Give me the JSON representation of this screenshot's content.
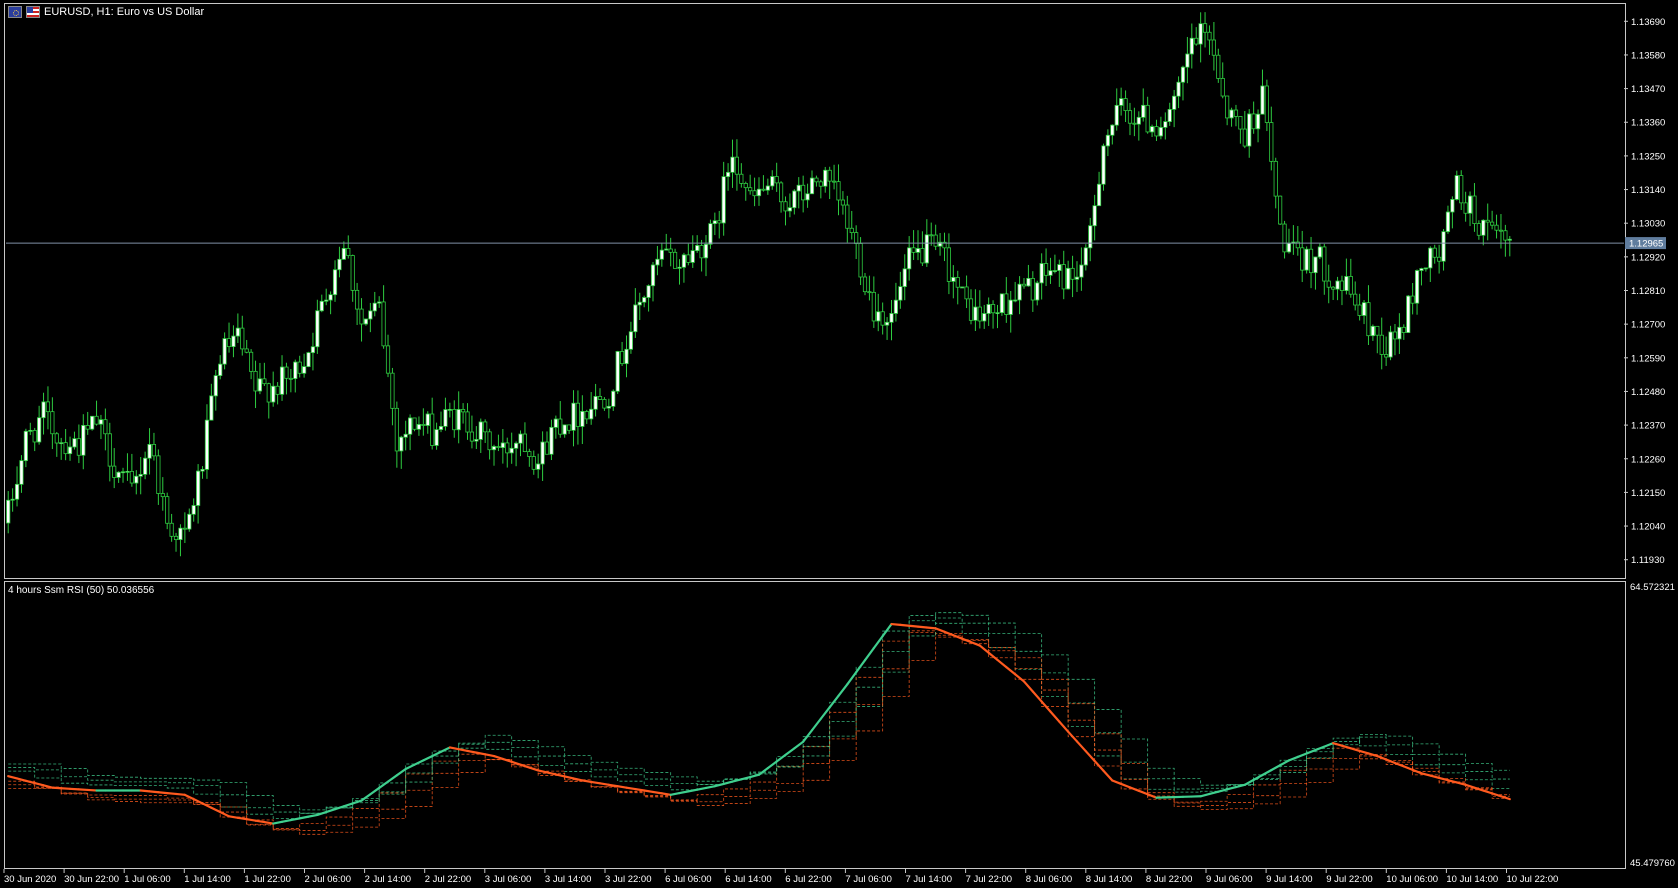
{
  "window": {
    "title": "EURUSD, H1:  Euro vs US Dollar",
    "flag_left_icon": "eu-flag-icon",
    "flag_right_icon": "us-flag-icon"
  },
  "colors": {
    "background": "#000000",
    "bull_candle": "#ffffff",
    "bear_candle": "#000000",
    "wick": "#2ecc40",
    "bid_line": "#7f8fa6",
    "rsi_up": "#3fcf8e",
    "rsi_down": "#ff5a1f",
    "level_up": "#3fcf8e",
    "level_down": "#ff5a1f"
  },
  "price_axis": {
    "labels": [
      "1.13690",
      "1.13580",
      "1.13470",
      "1.13360",
      "1.13250",
      "1.13140",
      "1.13030",
      "1.12920",
      "1.12810",
      "1.12700",
      "1.12590",
      "1.12480",
      "1.12370",
      "1.12260",
      "1.12150",
      "1.12040",
      "1.11930"
    ],
    "current_price": "1.12965",
    "range": [
      1.1188,
      1.1374
    ]
  },
  "indicator": {
    "title": "4 hours Ssm RSI (50) 50.036556",
    "max_label": "64.572321",
    "min_label": "45.479760",
    "range": [
      45.47976,
      64.572321
    ]
  },
  "time_axis": {
    "labels": [
      "30 Jun 2020",
      "30 Jun 22:00",
      "1 Jul 06:00",
      "1 Jul 14:00",
      "1 Jul 22:00",
      "2 Jul 06:00",
      "2 Jul 14:00",
      "2 Jul 22:00",
      "3 Jul 06:00",
      "3 Jul 14:00",
      "3 Jul 22:00",
      "6 Jul 06:00",
      "6 Jul 14:00",
      "6 Jul 22:00",
      "7 Jul 06:00",
      "7 Jul 14:00",
      "7 Jul 22:00",
      "8 Jul 06:00",
      "8 Jul 14:00",
      "8 Jul 22:00",
      "9 Jul 06:00",
      "9 Jul 14:00",
      "9 Jul 22:00",
      "10 Jul 06:00",
      "10 Jul 14:00",
      "10 Jul 22:00"
    ]
  },
  "chart_data": [
    {
      "type": "candlestick",
      "title": "EURUSD, H1:  Euro vs US Dollar",
      "ylim": [
        1.1188,
        1.1374
      ],
      "close_path": [
        [
          0,
          1.1208
        ],
        [
          4,
          1.1232
        ],
        [
          8,
          1.124
        ],
        [
          12,
          1.1232
        ],
        [
          16,
          1.1231
        ],
        [
          20,
          1.1238
        ],
        [
          24,
          1.1224
        ],
        [
          28,
          1.1215
        ],
        [
          32,
          1.1232
        ],
        [
          36,
          1.1205
        ],
        [
          40,
          1.12
        ],
        [
          44,
          1.1225
        ],
        [
          48,
          1.126
        ],
        [
          52,
          1.1265
        ],
        [
          56,
          1.1248
        ],
        [
          60,
          1.125
        ],
        [
          64,
          1.1252
        ],
        [
          68,
          1.1262
        ],
        [
          72,
          1.128
        ],
        [
          76,
          1.1298
        ],
        [
          80,
          1.127
        ],
        [
          84,
          1.1275
        ],
        [
          88,
          1.1232
        ],
        [
          92,
          1.1238
        ],
        [
          96,
          1.1235
        ],
        [
          100,
          1.124
        ],
        [
          104,
          1.1238
        ],
        [
          108,
          1.1232
        ],
        [
          112,
          1.1228
        ],
        [
          116,
          1.1235
        ],
        [
          120,
          1.1225
        ],
        [
          124,
          1.1238
        ],
        [
          128,
          1.124
        ],
        [
          132,
          1.1244
        ],
        [
          136,
          1.1248
        ],
        [
          140,
          1.1265
        ],
        [
          144,
          1.128
        ],
        [
          148,
          1.1292
        ],
        [
          152,
          1.129
        ],
        [
          156,
          1.1295
        ],
        [
          160,
          1.13
        ],
        [
          164,
          1.1328
        ],
        [
          168,
          1.131
        ],
        [
          172,
          1.1315
        ],
        [
          176,
          1.131
        ],
        [
          180,
          1.1312
        ],
        [
          184,
          1.1318
        ],
        [
          188,
          1.131
        ],
        [
          192,
          1.1295
        ],
        [
          196,
          1.1275
        ],
        [
          200,
          1.1272
        ],
        [
          204,
          1.129
        ],
        [
          208,
          1.1295
        ],
        [
          212,
          1.1292
        ],
        [
          216,
          1.1278
        ],
        [
          220,
          1.1272
        ],
        [
          224,
          1.1275
        ],
        [
          228,
          1.128
        ],
        [
          232,
          1.1282
        ],
        [
          236,
          1.1288
        ],
        [
          240,
          1.1285
        ],
        [
          244,
          1.129
        ],
        [
          248,
          1.133
        ],
        [
          252,
          1.134
        ],
        [
          256,
          1.1338
        ],
        [
          260,
          1.1335
        ],
        [
          264,
          1.134
        ],
        [
          268,
          1.1362
        ],
        [
          272,
          1.1365
        ],
        [
          276,
          1.134
        ],
        [
          280,
          1.1332
        ],
        [
          284,
          1.1345
        ],
        [
          288,
          1.13
        ],
        [
          292,
          1.129
        ],
        [
          296,
          1.1292
        ],
        [
          300,
          1.1285
        ],
        [
          304,
          1.128
        ],
        [
          308,
          1.127
        ],
        [
          312,
          1.1262
        ],
        [
          316,
          1.127
        ],
        [
          320,
          1.129
        ],
        [
          324,
          1.1292
        ],
        [
          328,
          1.1315
        ],
        [
          332,
          1.1305
        ],
        [
          336,
          1.1298
        ],
        [
          340,
          1.1296
        ]
      ]
    },
    {
      "type": "line",
      "title": "4 hours Ssm RSI (50) 50.036556",
      "ylim": [
        45.47976,
        64.572321
      ],
      "series": [
        {
          "name": "4 hours Ssm RSI (50)",
          "x": [
            0,
            10,
            20,
            30,
            40,
            50,
            60,
            70,
            80,
            90,
            100,
            110,
            120,
            130,
            140,
            150,
            160,
            170,
            180,
            190,
            200,
            210,
            220,
            230,
            240,
            250,
            260,
            270,
            280,
            290,
            300,
            310,
            320,
            330,
            340
          ],
          "values": [
            51.6,
            50.8,
            50.6,
            50.6,
            50.3,
            48.8,
            48.3,
            48.9,
            49.9,
            52.1,
            53.6,
            53.0,
            52.0,
            51.3,
            50.8,
            50.3,
            50.9,
            51.7,
            54.0,
            58.0,
            62.2,
            61.9,
            60.7,
            58.2,
            54.7,
            51.3,
            50.1,
            50.2,
            51.0,
            52.7,
            53.9,
            53.0,
            51.8,
            51.0,
            50.0
          ]
        }
      ]
    }
  ]
}
